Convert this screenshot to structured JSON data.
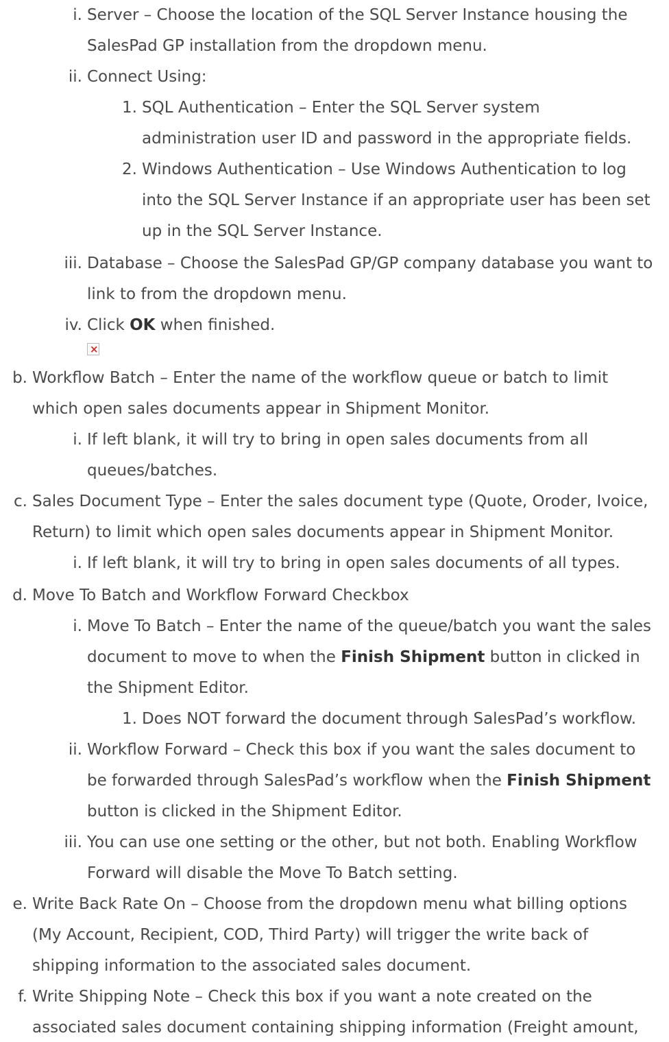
{
  "items": {
    "a_i": {
      "marker": "i.",
      "lines": [
        "Server – Choose the location of the SQL Server Instance housing the",
        "SalesPad GP installation from the dropdown menu."
      ]
    },
    "a_ii": {
      "marker": "ii.",
      "lines": [
        "Connect Using:"
      ]
    },
    "a_ii_1": {
      "marker": "1.",
      "lines": [
        "SQL Authentication – Enter the SQL Server system",
        "administration user ID and password in the appropriate fields."
      ]
    },
    "a_ii_2": {
      "marker": "2.",
      "lines": [
        "Windows Authentication – Use Windows Authentication to log",
        "into the SQL Server Instance if an appropriate user has been set",
        "up in the SQL Server Instance."
      ]
    },
    "a_iii": {
      "marker": "iii.",
      "lines": [
        "Database – Choose the SalesPad GP/GP company database you want to",
        "link to from the dropdown menu."
      ]
    },
    "a_iv": {
      "marker": "iv.",
      "pre": "Click ",
      "bold": "OK",
      "post": " when finished."
    },
    "b": {
      "marker": "b.",
      "lines": [
        "Workflow Batch – Enter the name of the workflow queue or batch to limit",
        "which open sales documents appear in Shipment Monitor."
      ]
    },
    "b_i": {
      "marker": "i.",
      "lines": [
        "If left blank, it will try to bring in open sales documents from all",
        "queues/batches."
      ]
    },
    "c": {
      "marker": "c.",
      "lines": [
        "Sales Document Type – Enter the sales document type (Quote, Oroder, Ivoice,",
        "Return) to limit which open sales documents appear in Shipment Monitor."
      ]
    },
    "c_i": {
      "marker": "i.",
      "lines": [
        "If left blank, it will try to bring in open sales documents of all types."
      ]
    },
    "d": {
      "marker": "d.",
      "lines": [
        "Move To Batch and Workflow Forward Checkbox"
      ]
    },
    "d_i": {
      "marker": "i.",
      "line1": "Move To Batch – Enter the name of the queue/batch you want the sales",
      "line2_pre": "document to move to when the ",
      "line2_bold": "Finish Shipment",
      "line2_post": " button in clicked in",
      "line3": "the Shipment Editor."
    },
    "d_i_1": {
      "marker": "1.",
      "lines": [
        "Does NOT forward the document through SalesPad’s workflow."
      ]
    },
    "d_ii": {
      "marker": "ii.",
      "line1": "Workflow Forward – Check this box if you want the sales document to",
      "line2_pre": "be forwarded through SalesPad’s workflow when the ",
      "line2_bold": "Finish Shipment",
      "line3": "button is clicked in the Shipment Editor."
    },
    "d_iii": {
      "marker": "iii.",
      "lines": [
        "You can use one setting or the other, but not both. Enabling Workflow",
        "Forward will disable the Move To Batch setting."
      ]
    },
    "e": {
      "marker": "e.",
      "lines": [
        "Write Back Rate On – Choose from the dropdown menu what billing options",
        "(My Account, Recipient, COD, Third Party) will trigger the write back of",
        "shipping information to the associated sales document."
      ]
    },
    "f": {
      "marker": "f.",
      "lines": [
        "Write Shipping Note – Check this box if you want a note created on the",
        "associated sales document containing shipping information (Freight amount,"
      ]
    }
  },
  "broken_image_icon": "broken-image-icon"
}
